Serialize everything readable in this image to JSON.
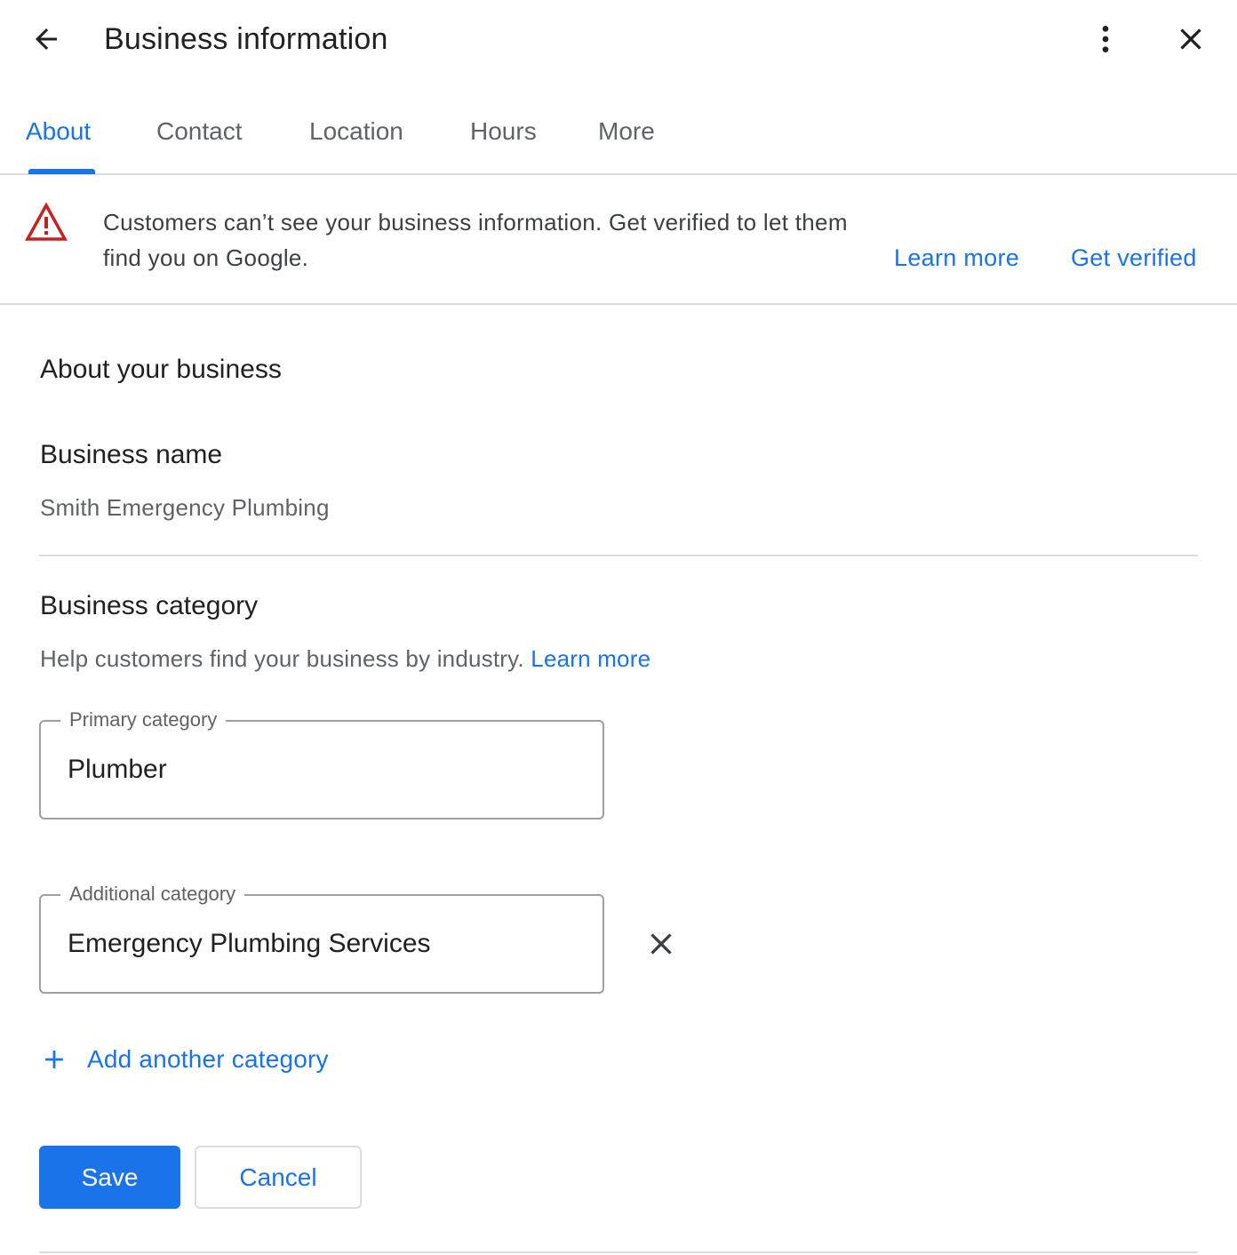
{
  "header": {
    "title": "Business information",
    "back_icon": "arrow-left-icon",
    "more_icon": "more-vert-icon",
    "close_icon": "close-icon"
  },
  "tabs": [
    {
      "label": "About",
      "active": true
    },
    {
      "label": "Contact",
      "active": false
    },
    {
      "label": "Location",
      "active": false
    },
    {
      "label": "Hours",
      "active": false
    },
    {
      "label": "More",
      "active": false
    }
  ],
  "banner": {
    "icon": "warning-icon",
    "message": "Customers can’t see your business information. Get verified to let them find you on Google.",
    "learn_more": "Learn more",
    "get_verified": "Get verified"
  },
  "about": {
    "section_title": "About your business",
    "business_name_label": "Business name",
    "business_name_value": "Smith Emergency Plumbing",
    "category_label": "Business category",
    "category_help": "Help customers find your business by industry.",
    "category_help_link": "Learn more",
    "primary_category_label": "Primary category",
    "primary_category_value": "Plumber",
    "additional_category_label": "Additional category",
    "additional_category_value": "Emergency Plumbing Services",
    "add_category_label": "Add another category"
  },
  "actions": {
    "save": "Save",
    "cancel": "Cancel"
  },
  "colors": {
    "accent": "#1a73e8",
    "warning": "#c5221f",
    "text_primary": "#202124",
    "text_secondary": "#5f6368",
    "divider": "#dadce0"
  }
}
